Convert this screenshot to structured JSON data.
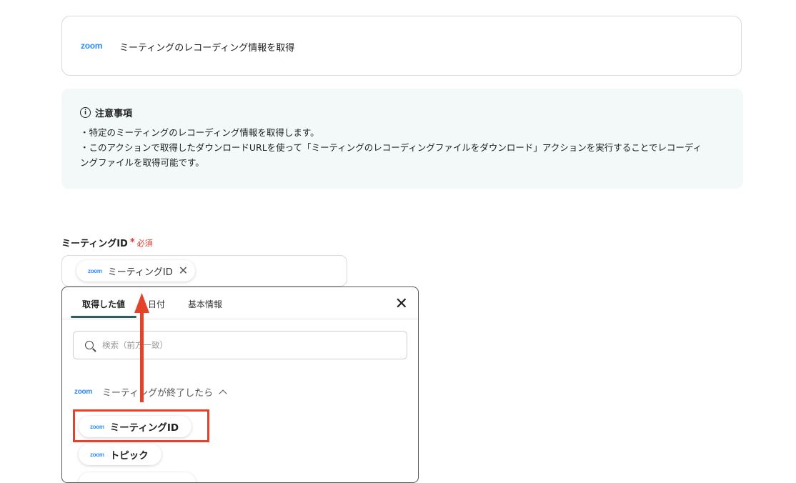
{
  "action_card": {
    "logo": "zoom",
    "title": "ミーティングのレコーディング情報を取得"
  },
  "notice": {
    "icon": "info-icon",
    "title": "注意事項",
    "lines": [
      "・特定のミーティングのレコーディング情報を取得します。",
      "・このアクションで取得したダウンロードURLを使って「ミーティングのレコーディングファイルをダウンロード」アクションを実行することでレコーディ",
      "ングファイルを取得可能です。"
    ]
  },
  "field": {
    "label": "ミーティングID",
    "required_mark": "*",
    "required_text": "必須",
    "chip": {
      "logo": "zoom",
      "label": "ミーティングID",
      "remove_icon": "close-icon"
    }
  },
  "dropdown": {
    "tabs": [
      {
        "label": "取得した値",
        "active": true
      },
      {
        "label": "日付",
        "active": false
      },
      {
        "label": "基本情報",
        "active": false
      }
    ],
    "search_placeholder": "検索（前方一致）",
    "group": {
      "logo": "zoom",
      "label": "ミーティングが終了したら",
      "expanded": true
    },
    "items": [
      {
        "logo": "zoom",
        "label": "ミーティングID",
        "highlighted": true
      },
      {
        "logo": "zoom",
        "label": "トピック",
        "highlighted": false
      }
    ]
  },
  "colors": {
    "accent": "#2f5d62",
    "zoom_blue": "#2d8cff",
    "required_red": "#e4332b",
    "annotation_red": "#e4432b",
    "notice_bg": "#f3f9f9"
  }
}
